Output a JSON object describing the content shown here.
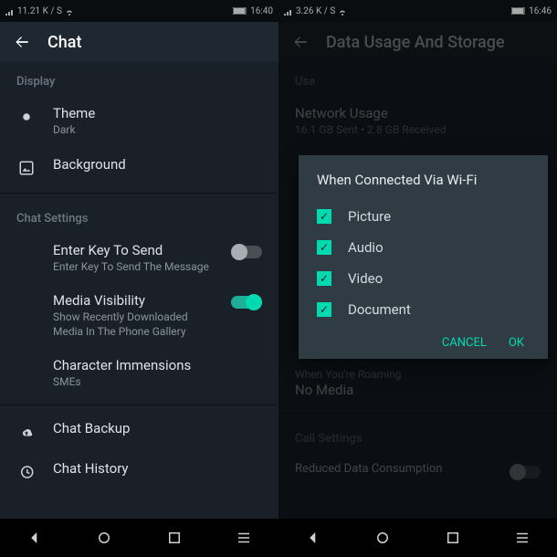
{
  "left": {
    "status": {
      "net": "11.21 K / S",
      "time": "16:40"
    },
    "appbar": {
      "title": "Chat"
    },
    "section_display": "Display",
    "theme": {
      "label": "Theme",
      "value": "Dark"
    },
    "background": {
      "label": "Background"
    },
    "section_chat": "Chat Settings",
    "enter_key": {
      "title": "Enter Key To Send",
      "sub": "Enter Key To Send The Message"
    },
    "media_vis": {
      "title": "Media Visibility",
      "sub": "Show Recently Downloaded Media In The Phone Gallery"
    },
    "char": {
      "title": "Character Immensions",
      "sub": "SMEs"
    },
    "backup": "Chat Backup",
    "history": "Chat History"
  },
  "right": {
    "status": {
      "net": "3.26 K / S",
      "time": "16:46"
    },
    "appbar": {
      "title": "Data Usage And Storage"
    },
    "section_use": "Use",
    "usage": {
      "title": "Network Usage",
      "sub": "16.1 GB Sent • 2.8 GB Received"
    },
    "roaming": {
      "title": "When You're Roaming",
      "value": "No Media"
    },
    "section_call": "Call Settings",
    "reduced": "Reduced Data Consumption",
    "dialog": {
      "title": "When Connected Via Wi-Fi",
      "opts": [
        "Picture",
        "Audio",
        "Video",
        "Document"
      ],
      "cancel": "CANCEL",
      "ok": "OK"
    }
  }
}
